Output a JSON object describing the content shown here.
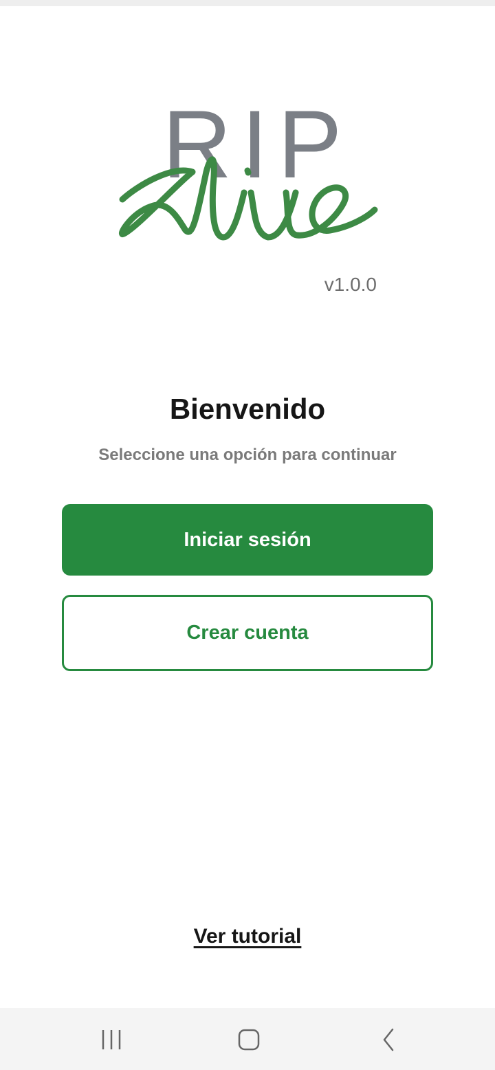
{
  "app": {
    "logo_text": "RIP",
    "logo_script": "alive",
    "version": "v1.0.0"
  },
  "welcome": {
    "title": "Bienvenido",
    "subtitle": "Seleccione una opción para continuar"
  },
  "actions": {
    "login_label": "Iniciar sesión",
    "create_account_label": "Crear cuenta",
    "tutorial_label": "Ver tutorial"
  },
  "colors": {
    "brand_green": "#268a3f",
    "logo_gray": "#7b7f86"
  },
  "icons": {
    "recents": "recent-apps-icon",
    "home": "home-icon",
    "back": "back-icon"
  }
}
